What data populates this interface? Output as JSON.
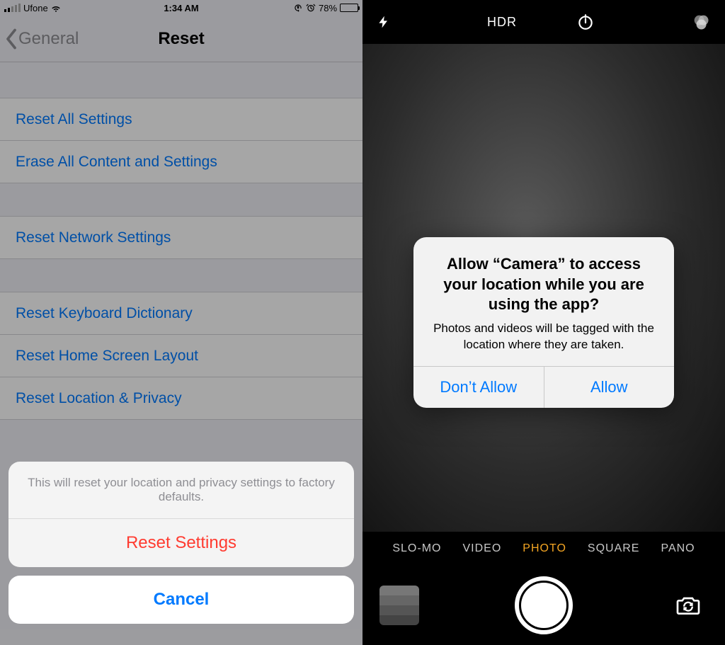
{
  "left": {
    "status": {
      "carrier": "Ufone",
      "time": "1:34 AM",
      "battery_pct": "78%"
    },
    "nav": {
      "back_label": "General",
      "title": "Reset"
    },
    "rows": {
      "reset_all": "Reset All Settings",
      "erase_all": "Erase All Content and Settings",
      "reset_network": "Reset Network Settings",
      "reset_keyboard": "Reset Keyboard Dictionary",
      "reset_home": "Reset Home Screen Layout",
      "reset_location": "Reset Location & Privacy"
    },
    "action_sheet": {
      "message": "This will reset your location and privacy settings to factory defaults.",
      "destructive": "Reset Settings",
      "cancel": "Cancel"
    }
  },
  "right": {
    "top": {
      "hdr": "HDR"
    },
    "modes": {
      "slomo": "SLO-MO",
      "video": "VIDEO",
      "photo": "PHOTO",
      "square": "SQUARE",
      "pano": "PANO"
    },
    "alert": {
      "title": "Allow “Camera” to access your location while you are using the app?",
      "message": "Photos and videos will be tagged with the location where they are taken.",
      "deny": "Don’t Allow",
      "allow": "Allow"
    }
  }
}
